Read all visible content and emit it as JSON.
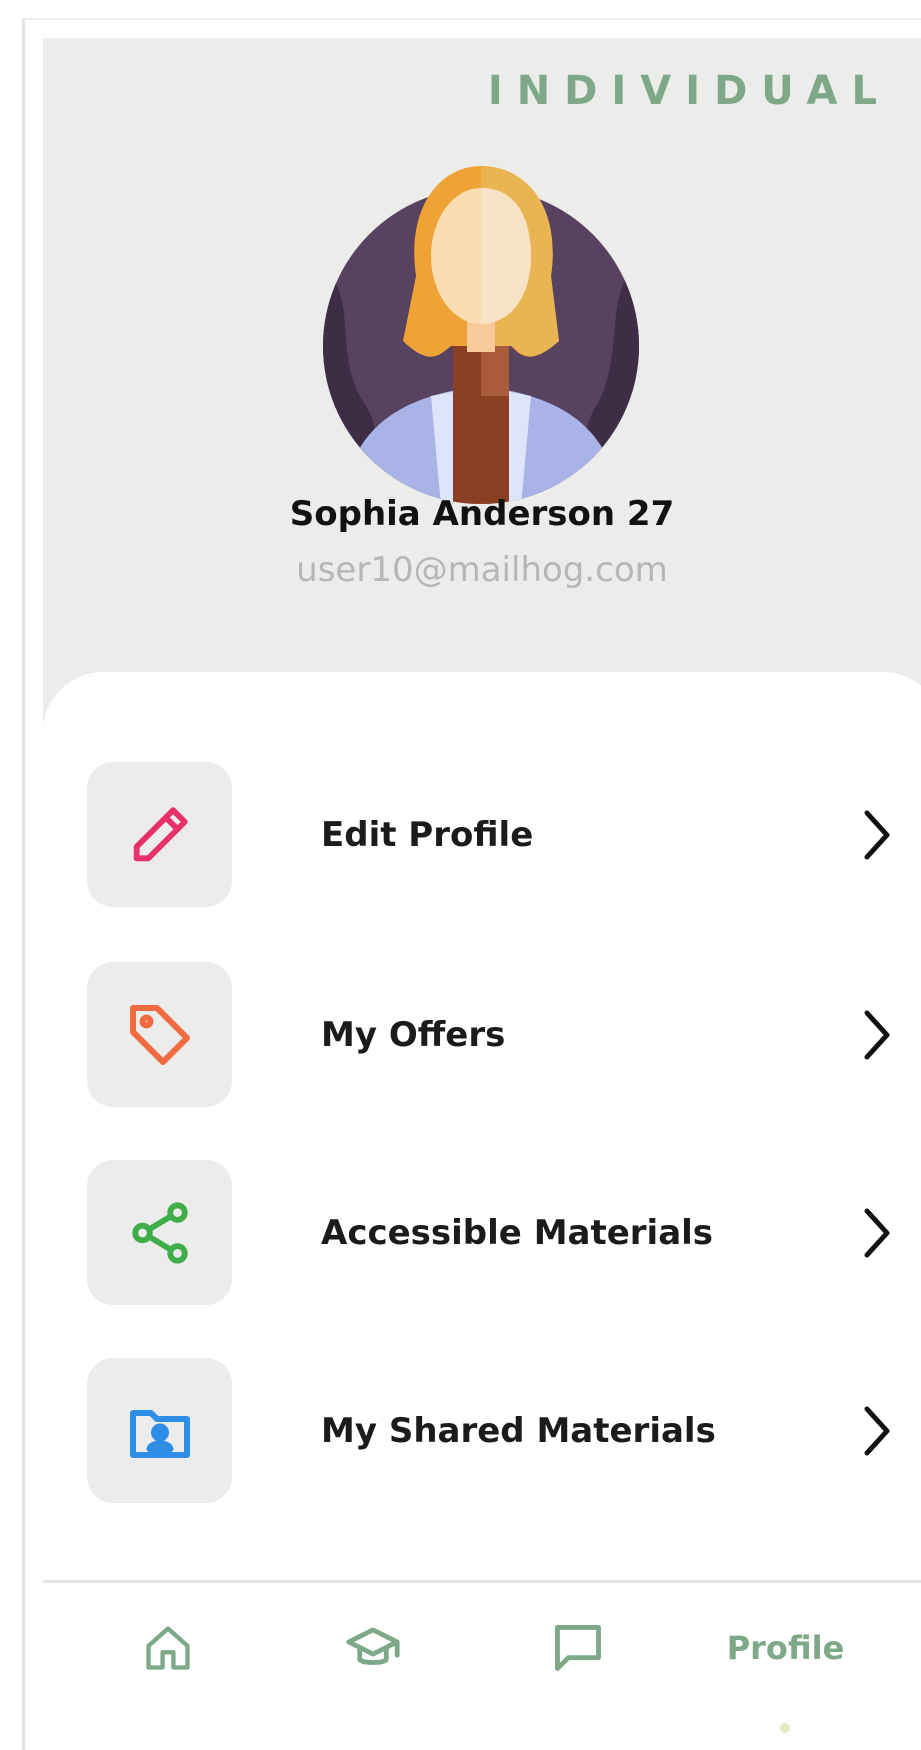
{
  "account": {
    "type_badge": "INDIVIDUAL"
  },
  "user": {
    "name": "Sophia Anderson 27",
    "email": "user10@mailhog.com"
  },
  "menu": {
    "items": [
      {
        "label": "Edit Profile",
        "icon": "pencil-icon",
        "icon_color": "#e8316b"
      },
      {
        "label": "My Offers",
        "icon": "tag-icon",
        "icon_color": "#f26a3f"
      },
      {
        "label": "Accessible Materials",
        "icon": "share-icon",
        "icon_color": "#3fae49"
      },
      {
        "label": "My Shared Materials",
        "icon": "folder-user-icon",
        "icon_color": "#2f8fe8"
      }
    ]
  },
  "nav": {
    "items": [
      {
        "icon": "home-icon"
      },
      {
        "icon": "graduation-cap-icon"
      },
      {
        "icon": "chat-icon"
      },
      {
        "label": "Profile",
        "active": true
      }
    ],
    "accent_color": "#7fa889"
  }
}
